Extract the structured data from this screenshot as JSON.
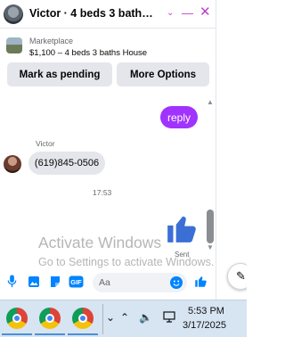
{
  "header": {
    "title": "Victor · 4 beds 3 baths Ho...",
    "accent_color": "#c13cc9"
  },
  "listing": {
    "source": "Marketplace",
    "title": "$1,100 – 4 beds 3 baths House"
  },
  "actions": {
    "mark_pending": "Mark as pending",
    "more_options": "More Options"
  },
  "messages": {
    "outgoing_text": "reply",
    "sender_name": "Victor",
    "incoming_text": "(619)845-0506",
    "timestamp": "17:53",
    "status": "Sent",
    "outgoing_color": "#a033ff"
  },
  "watermark": {
    "line1": "Activate Windows",
    "line2": "Go to Settings to activate Windows."
  },
  "composer": {
    "placeholder": "Aa",
    "gif_label": "GIF",
    "like_color": "#0084ff"
  },
  "taskbar": {
    "time": "5:53 PM",
    "date": "3/17/2025"
  }
}
